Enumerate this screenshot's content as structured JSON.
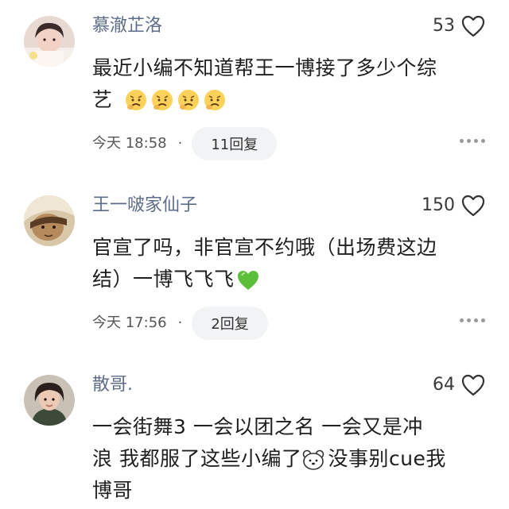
{
  "comments": [
    {
      "username": "慕澈芷洛",
      "likes": "53",
      "line1": "最近小编不知道帮王一博接了多少个综",
      "line2": "艺",
      "time": "今天 18:58",
      "separator": "·",
      "reply_label": "11回复",
      "emoji": "worried-face-icon"
    },
    {
      "username": "王一啵家仙子",
      "likes": "150",
      "line1": "官宣了吗，非官宣不约哦（出场费这边",
      "line2": "结）一博飞飞飞",
      "time": "今天 17:56",
      "separator": "·",
      "reply_label": "2回复",
      "emoji": "green-heart-icon"
    },
    {
      "username": "散哥.",
      "likes": "64",
      "line1": "一会街舞3 一会以团之名 一会又是冲",
      "line2a": "浪 我都服了这些小编了",
      "line2b": "没事别cue我",
      "line3": "博哥",
      "emoji": "bear-face-icon"
    }
  ]
}
